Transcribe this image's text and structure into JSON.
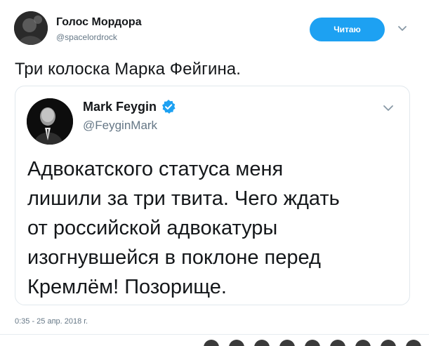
{
  "author": {
    "name": "Голос Мордора",
    "handle": "@spacelordrock",
    "avatar_icon": "avatar-image"
  },
  "follow_button": {
    "label": "Читаю",
    "color": "#1da1f2"
  },
  "tweet": {
    "text": "Три колоска Марка Фейгина."
  },
  "quoted": {
    "name": "Mark Feygin",
    "handle": "@FeyginMark",
    "verified": true,
    "verified_color": "#1da1f2",
    "lines": [
      "Адвокатского статуса меня",
      "лишили за три твита. Чего ждать",
      "от российской адвокатуры",
      "изогнувшейся в поклоне перед",
      "Кремлём! Позорище."
    ]
  },
  "timestamp": "0:35 - 25 апр. 2018 г.",
  "action_icons": [
    "action-icon",
    "action-icon",
    "action-icon",
    "action-icon",
    "action-icon",
    "action-icon",
    "action-icon",
    "action-icon",
    "action-icon"
  ]
}
